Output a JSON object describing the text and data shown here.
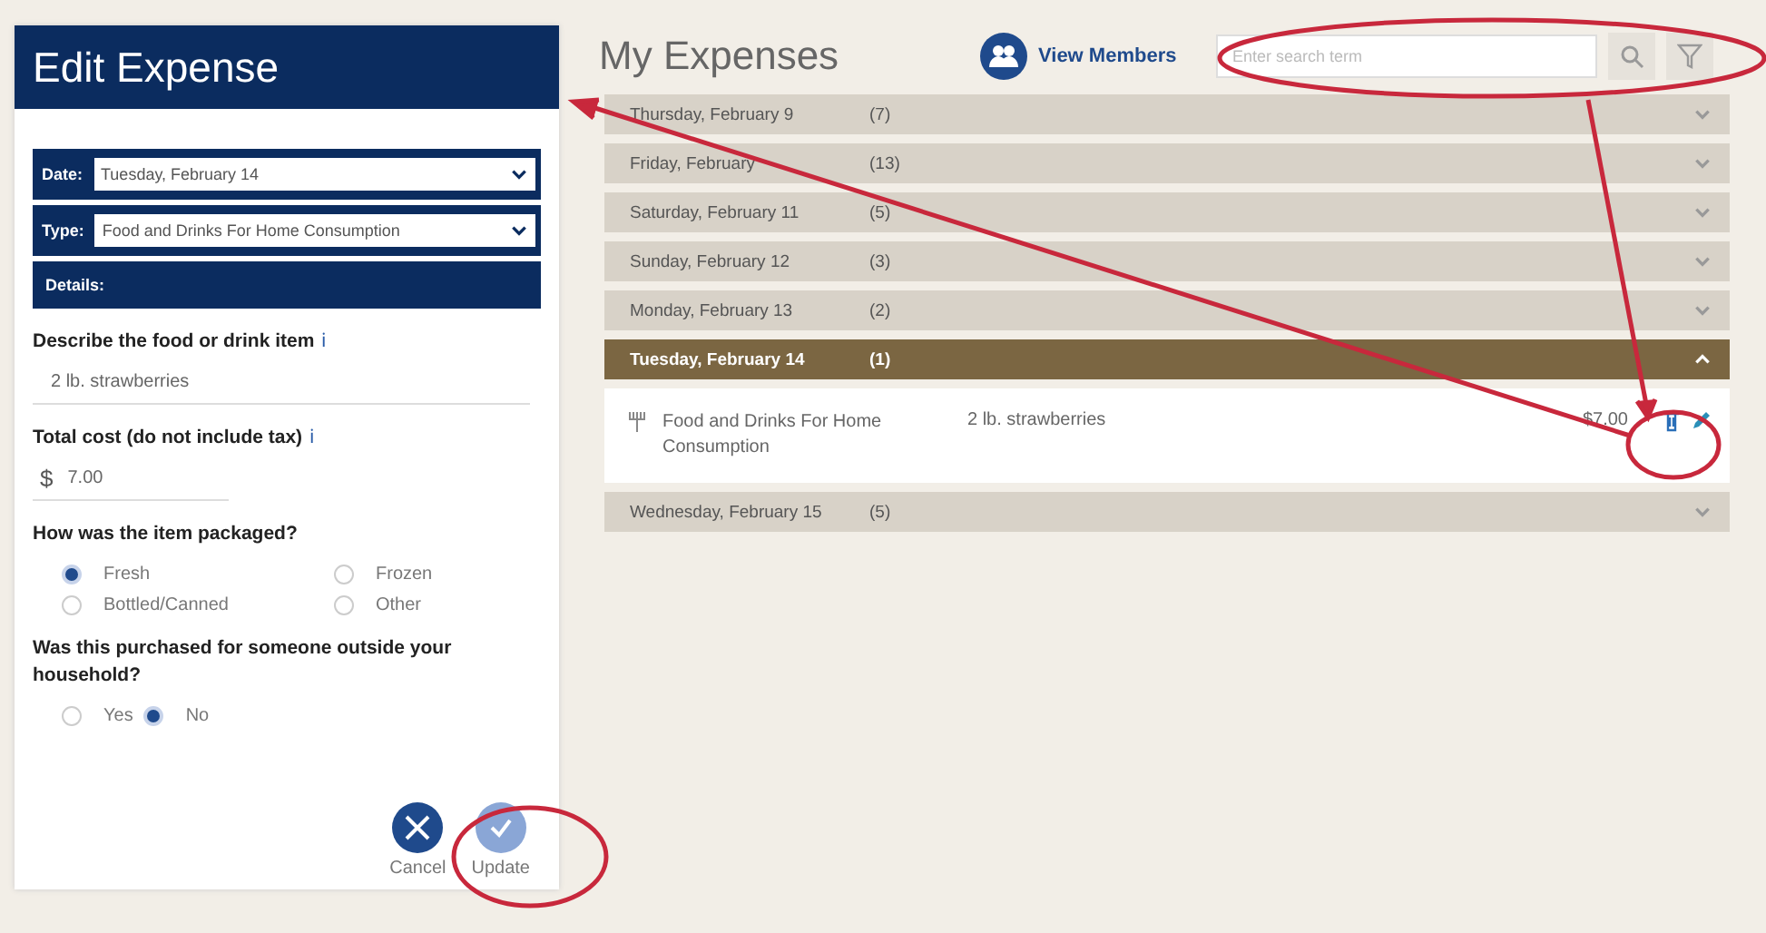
{
  "edit_panel": {
    "title": "Edit Expense",
    "selects": [
      {
        "label": "Date:",
        "value": "Tuesday, February 14"
      },
      {
        "label": "Type:",
        "value": "Food and Drinks For Home Consumption"
      }
    ],
    "details_label": "Details:",
    "describe": {
      "label": "Describe the food or drink item",
      "info": "ℹ",
      "value": "2 lb. strawberries"
    },
    "cost": {
      "label": "Total cost (do not include tax)",
      "info": "ℹ",
      "currency": "$",
      "value": "7.00"
    },
    "packaged": {
      "label": "How was the item packaged?",
      "options": [
        {
          "label": "Fresh",
          "selected": true
        },
        {
          "label": "Frozen",
          "selected": false
        },
        {
          "label": "Bottled/Canned",
          "selected": false
        },
        {
          "label": "Other",
          "selected": false
        }
      ]
    },
    "outside": {
      "label": "Was this purchased for someone outside your household?",
      "options": [
        {
          "label": "Yes",
          "selected": false
        },
        {
          "label": "No",
          "selected": true
        }
      ]
    },
    "buttons": [
      {
        "kind": "cancel",
        "label": "Cancel"
      },
      {
        "kind": "update",
        "label": "Update"
      }
    ]
  },
  "expenses": {
    "title": "My Expenses",
    "view_members": "View Members",
    "search": {
      "placeholder": "Enter search term"
    },
    "days": [
      {
        "label": "Thursday, February 9",
        "count": "(7)",
        "expanded": false
      },
      {
        "label": "Friday, February",
        "count": "(13)",
        "expanded": false
      },
      {
        "label": "Saturday, February 11",
        "count": "(5)",
        "expanded": false
      },
      {
        "label": "Sunday, February 12",
        "count": "(3)",
        "expanded": false
      },
      {
        "label": "Monday, February 13",
        "count": "(2)",
        "expanded": false
      },
      {
        "label": "Tuesday, February 14",
        "count": "(1)",
        "expanded": true,
        "items": [
          {
            "type": "Food and Drinks For Home Consumption",
            "description": "2 lb. strawberries",
            "amount": "$7.00"
          }
        ]
      },
      {
        "label": "Wednesday, February 15",
        "count": "(5)",
        "expanded": false
      }
    ]
  }
}
